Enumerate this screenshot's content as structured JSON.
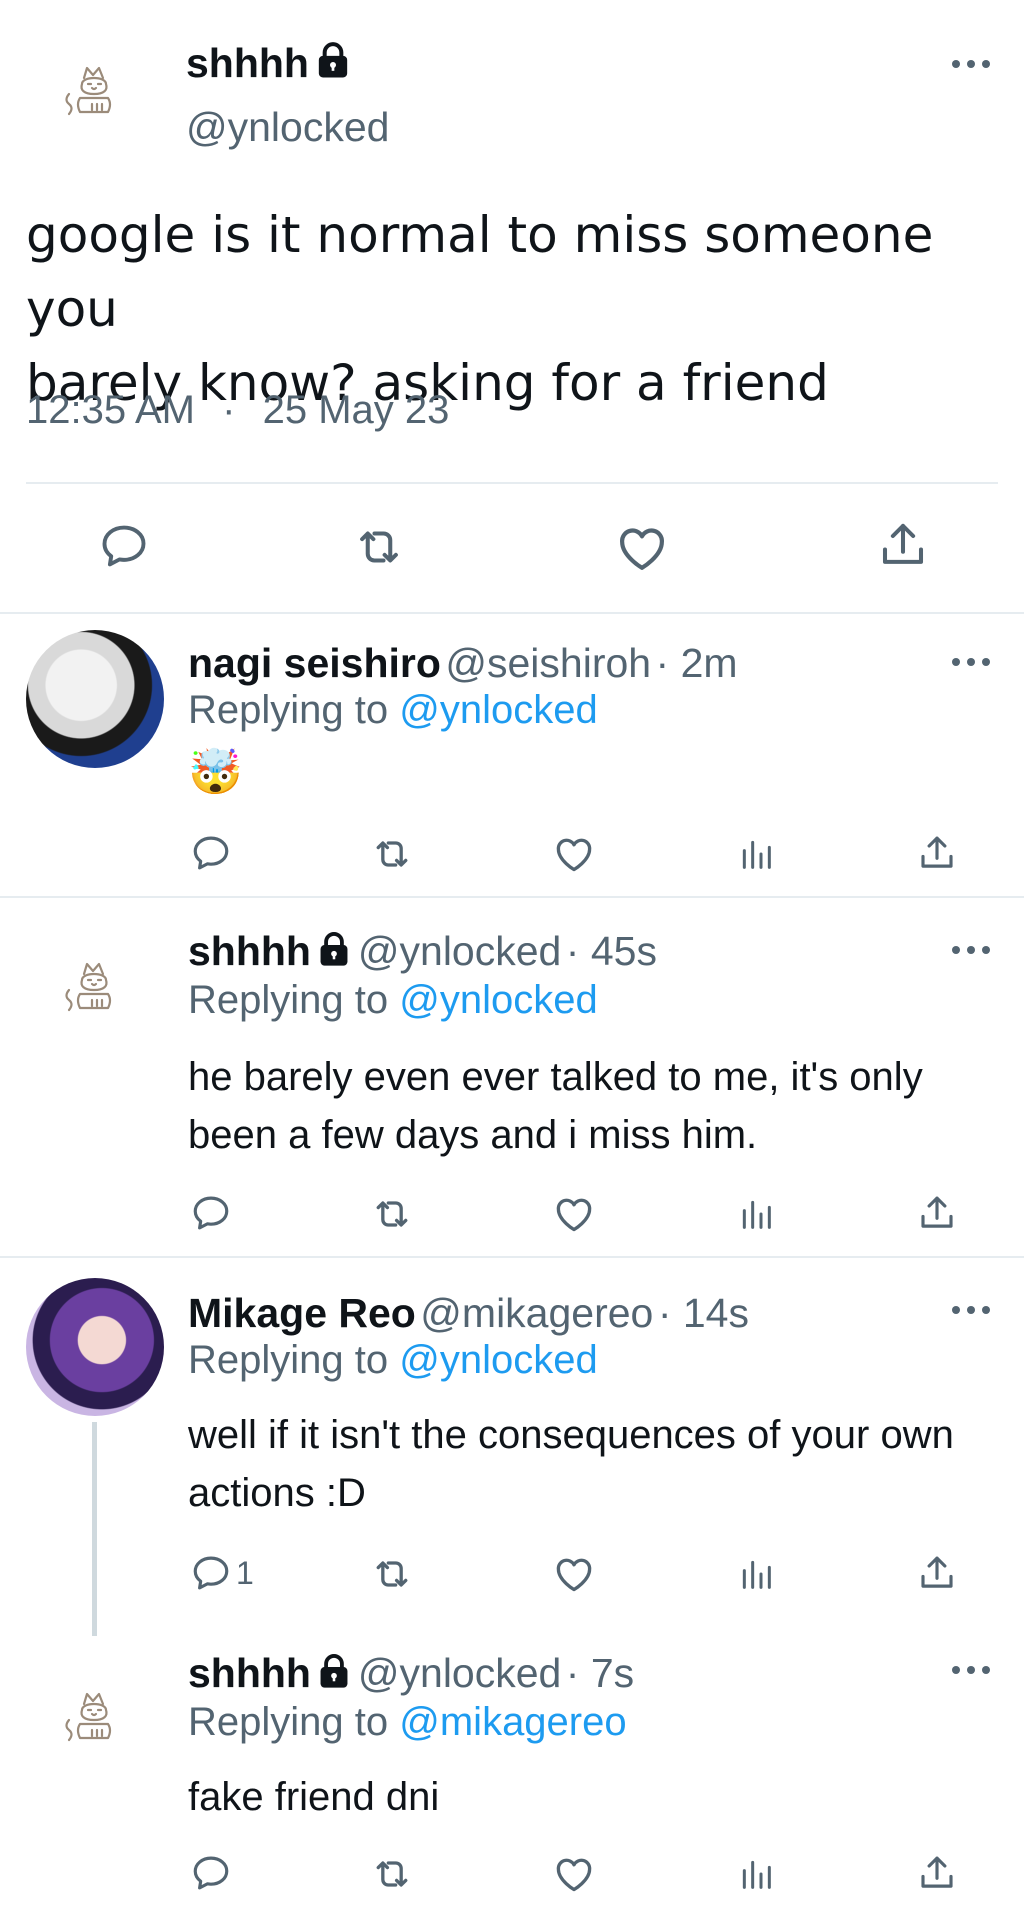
{
  "main_tweet": {
    "name": "shhhh",
    "handle": "@ynlocked",
    "text_line1": "google is it normal to miss someone you",
    "text_line2": "barely know? asking for a friend",
    "time": "12:35 AM",
    "separator": "·",
    "date": "25 May 23"
  },
  "replies": [
    {
      "name": "nagi seishiro",
      "handle": "@seishiroh",
      "age": "· 2m",
      "replying_prefix": "Replying to",
      "replying_to": "@ynlocked",
      "text": "🤯",
      "reply_count": ""
    },
    {
      "name": "shhhh",
      "handle": "@ynlocked",
      "age": "· 45s",
      "replying_prefix": "Replying to",
      "replying_to": "@ynlocked",
      "text_line1": "he barely even ever talked to me, it's only",
      "text_line2": "been a few days and i miss him.",
      "reply_count": ""
    },
    {
      "name": "Mikage Reo",
      "handle": "@mikagereo",
      "age": "· 14s",
      "replying_prefix": "Replying to",
      "replying_to": "@ynlocked",
      "text_line1": "well if it isn't the consequences of your own",
      "text_line2": "actions :D",
      "reply_count": "1"
    },
    {
      "name": "shhhh",
      "handle": "@ynlocked",
      "age": "· 7s",
      "replying_prefix": "Replying to",
      "replying_to": "@mikagereo",
      "text": "fake friend dni",
      "reply_count": ""
    }
  ],
  "icons": {
    "reply": "comment-icon",
    "retweet": "retweet-icon",
    "like": "heart-icon",
    "views": "analytics-icon",
    "share": "share-icon",
    "lock": "lock-icon",
    "more": "more-icon"
  },
  "colors": {
    "link": "#1d9bf0",
    "secondary_text": "#536471",
    "divider": "#e6ecf0"
  }
}
